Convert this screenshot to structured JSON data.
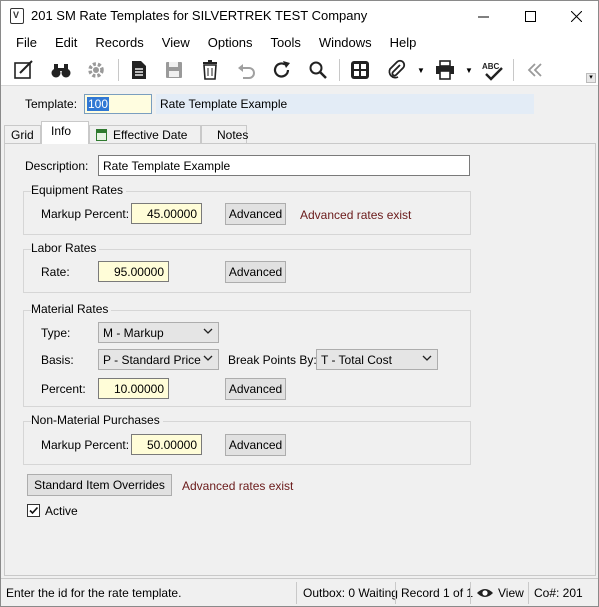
{
  "window": {
    "title": "201 SM Rate Templates for SILVERTREK TEST Company",
    "icon": "app-document-v-icon",
    "controls": {
      "minimize": "—",
      "maximize": "☐",
      "close": "✕"
    }
  },
  "menu": [
    "File",
    "Edit",
    "Records",
    "View",
    "Options",
    "Tools",
    "Windows",
    "Help"
  ],
  "toolbar": {
    "icons": [
      "edit-icon",
      "binoculars-icon",
      "gear-icon",
      "document-icon",
      "save-icon",
      "delete-icon",
      "undo-icon",
      "refresh-icon",
      "search-icon",
      "calculator-icon",
      "attachment-icon",
      "print-icon",
      "spellcheck-icon",
      "collapse-icon"
    ],
    "spellcheck_text": "ABC"
  },
  "template": {
    "label": "Template:",
    "value": "100",
    "description": "Rate Template Example"
  },
  "tabs": [
    {
      "label": "Grid",
      "active": false
    },
    {
      "label": "Info",
      "active": true
    },
    {
      "label": "Effective Date",
      "active": false,
      "icon": "calendar-icon"
    },
    {
      "label": "Notes",
      "active": false
    }
  ],
  "info": {
    "description_label": "Description:",
    "description_value": "Rate Template Example",
    "equipment": {
      "title": "Equipment Rates",
      "markup_label": "Markup Percent:",
      "markup_value": "45.00000",
      "advanced_label": "Advanced",
      "note": "Advanced rates exist"
    },
    "labor": {
      "title": "Labor Rates",
      "rate_label": "Rate:",
      "rate_value": "95.00000",
      "advanced_label": "Advanced"
    },
    "material": {
      "title": "Material Rates",
      "type_label": "Type:",
      "type_value": "M - Markup",
      "basis_label": "Basis:",
      "basis_value": "P - Standard Price",
      "breakpoints_label": "Break Points By:",
      "breakpoints_value": "T - Total Cost",
      "percent_label": "Percent:",
      "percent_value": "10.00000",
      "advanced_label": "Advanced"
    },
    "nonmaterial": {
      "title": "Non-Material Purchases",
      "markup_label": "Markup Percent:",
      "markup_value": "50.00000",
      "advanced_label": "Advanced"
    },
    "overrides_button": "Standard Item Overrides",
    "overrides_note": "Advanced rates exist",
    "active_label": "Active",
    "active_checked": true
  },
  "status": {
    "message": "Enter the id for the rate template.",
    "outbox": "Outbox: 0 Waiting",
    "record": "Record 1 of 1",
    "view": "View",
    "company": "Co#: 201"
  }
}
